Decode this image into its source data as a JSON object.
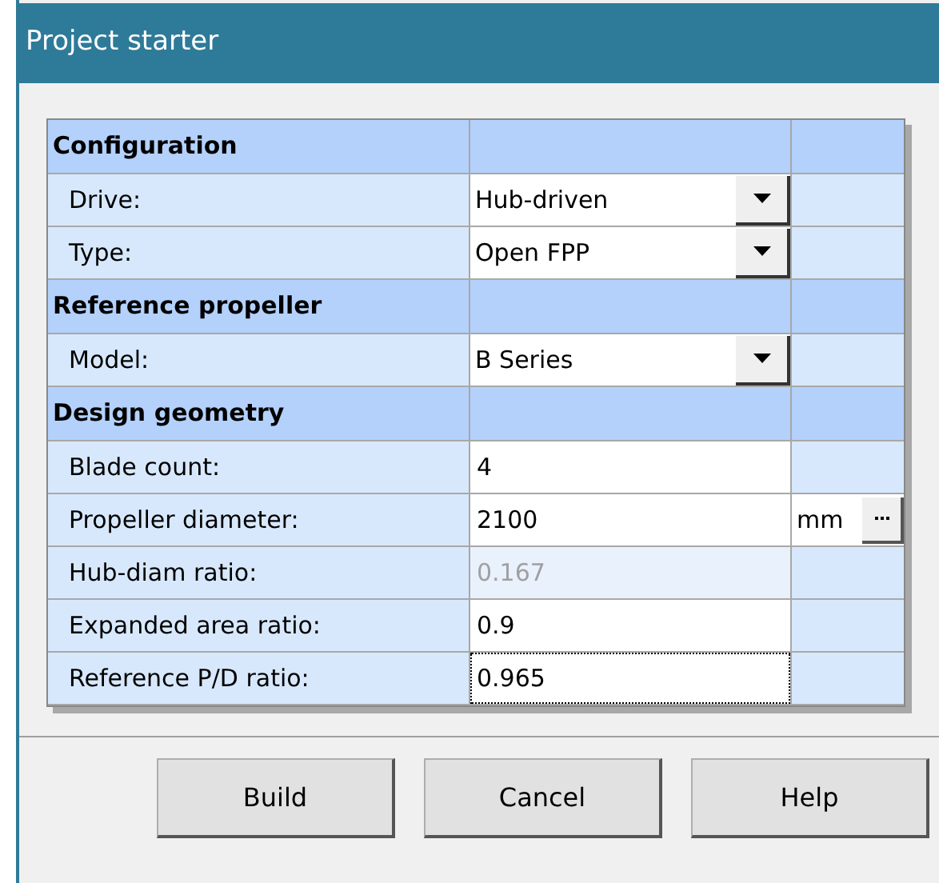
{
  "window": {
    "title": "Project starter"
  },
  "sections": [
    {
      "title": "Configuration",
      "rows": [
        {
          "label": "Drive:",
          "kind": "dropdown",
          "value": "Hub-driven"
        },
        {
          "label": "Type:",
          "kind": "dropdown",
          "value": "Open FPP"
        }
      ]
    },
    {
      "title": "Reference propeller",
      "rows": [
        {
          "label": "Model:",
          "kind": "dropdown",
          "value": "B Series"
        }
      ]
    },
    {
      "title": "Design geometry",
      "rows": [
        {
          "label": "Blade count:",
          "kind": "text",
          "value": "4",
          "disabled": false,
          "focused": false
        },
        {
          "label": "Propeller diameter:",
          "kind": "text",
          "value": "2100",
          "disabled": false,
          "focused": false,
          "unit": "mm"
        },
        {
          "label": "Hub-diam ratio:",
          "kind": "text",
          "value": "0.167",
          "disabled": true,
          "focused": false
        },
        {
          "label": "Expanded area ratio:",
          "kind": "text",
          "value": "0.9",
          "disabled": false,
          "focused": false
        },
        {
          "label": "Reference P/D ratio:",
          "kind": "text",
          "value": "0.965",
          "disabled": false,
          "focused": true
        }
      ]
    }
  ],
  "buttons": [
    "Build",
    "Cancel",
    "Help"
  ]
}
